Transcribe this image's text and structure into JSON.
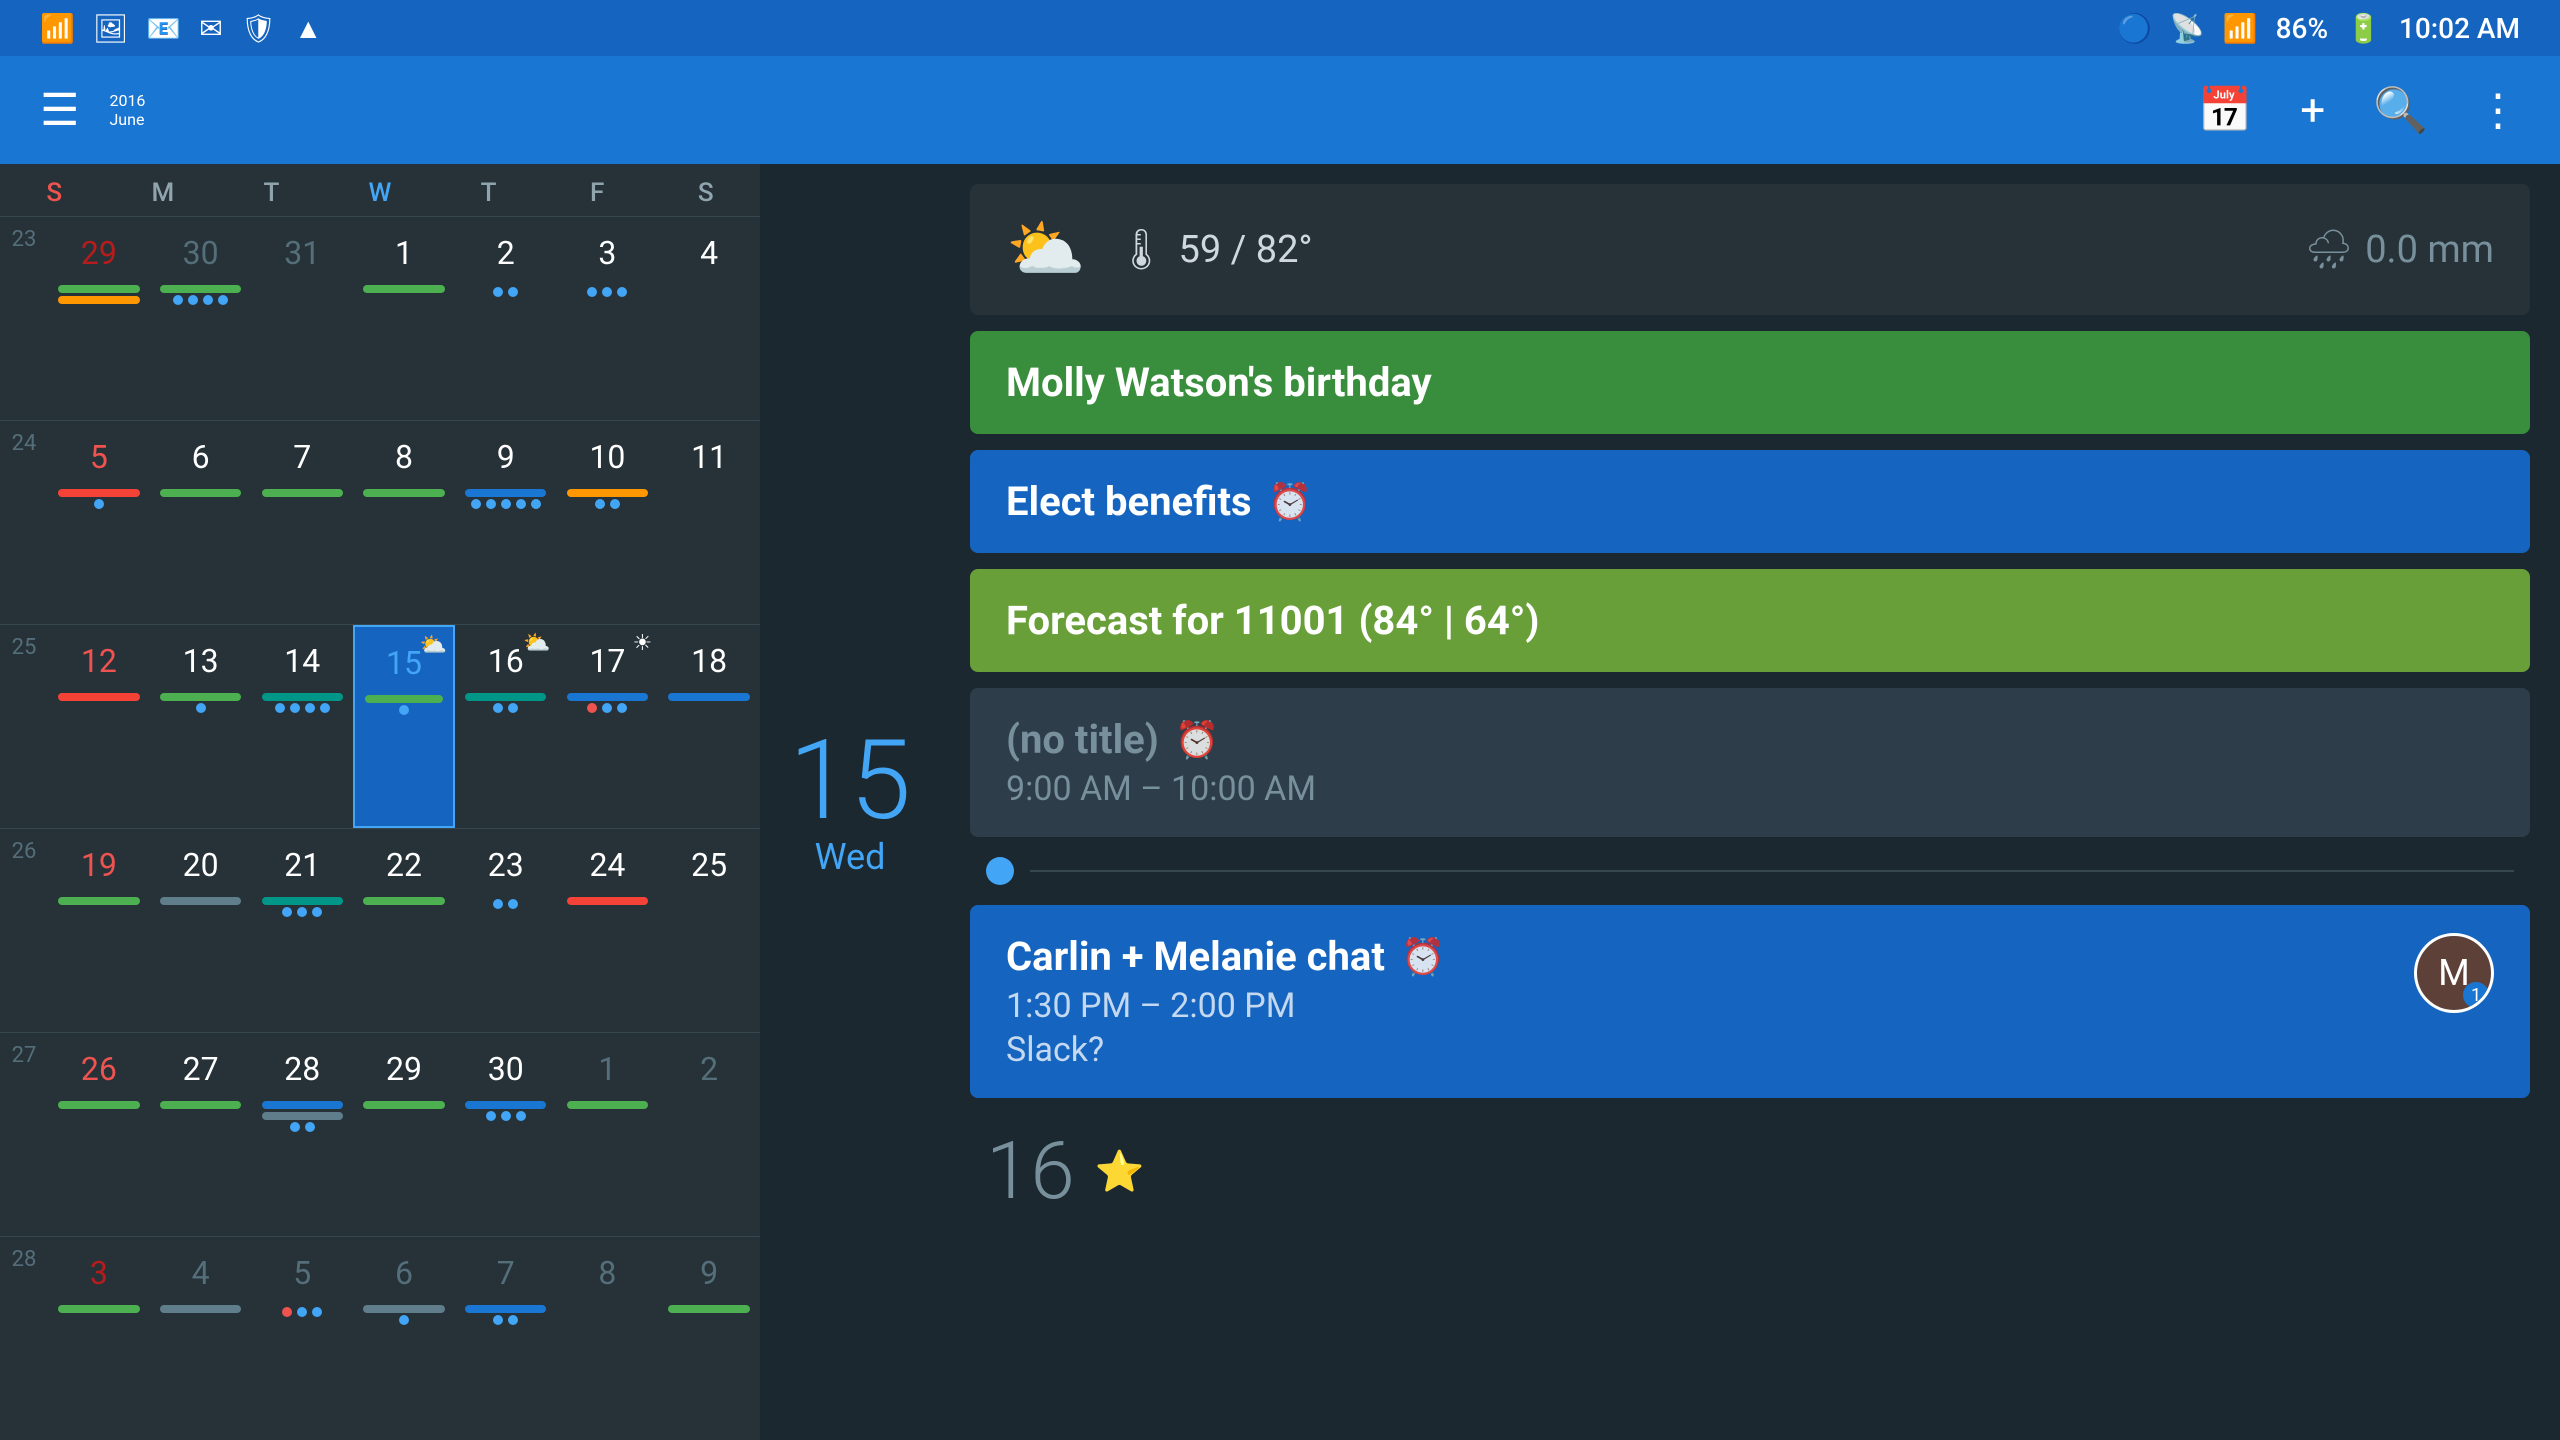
{
  "statusBar": {
    "time": "10:02 AM",
    "battery": "86%",
    "signal": "●●●●",
    "wifi": "WiFi",
    "bluetooth": "BT"
  },
  "appBar": {
    "year": "2016",
    "month": "June",
    "menuIcon": "☰",
    "calendarIcon": "📅",
    "addIcon": "+",
    "searchIcon": "🔍",
    "moreIcon": "⋮"
  },
  "calendar": {
    "weekNumbers": [
      23,
      24,
      25,
      26,
      27,
      28
    ],
    "dayHeaders": [
      "S",
      "M",
      "T",
      "W",
      "T",
      "F",
      "S"
    ],
    "weeks": [
      {
        "weekNum": 23,
        "days": [
          {
            "num": "29",
            "type": "overflow sunday",
            "bars": [
              "green",
              "orange"
            ],
            "dots": []
          },
          {
            "num": "30",
            "type": "overflow",
            "bars": [
              "green"
            ],
            "dots": [
              "blue",
              "blue",
              "blue",
              "blue"
            ]
          },
          {
            "num": "31",
            "type": "overflow",
            "bars": [],
            "dots": []
          },
          {
            "num": "1",
            "type": "normal wednesday",
            "bars": [
              "green"
            ],
            "dots": []
          },
          {
            "num": "2",
            "type": "normal",
            "bars": [],
            "dots": [
              "blue",
              "blue"
            ]
          },
          {
            "num": "3",
            "type": "normal",
            "bars": [],
            "dots": [
              "blue",
              "blue",
              "blue"
            ]
          },
          {
            "num": "4",
            "type": "normal",
            "bars": [],
            "dots": []
          }
        ]
      },
      {
        "weekNum": 24,
        "days": [
          {
            "num": "5",
            "type": "sunday",
            "bars": [
              "red"
            ],
            "dots": [
              "blue"
            ]
          },
          {
            "num": "6",
            "type": "normal",
            "bars": [
              "green"
            ],
            "dots": []
          },
          {
            "num": "7",
            "type": "normal",
            "bars": [
              "green"
            ],
            "dots": []
          },
          {
            "num": "8",
            "type": "normal wednesday",
            "bars": [
              "green"
            ],
            "dots": []
          },
          {
            "num": "9",
            "type": "normal",
            "bars": [
              "blue"
            ],
            "dots": [
              "blue",
              "blue",
              "blue",
              "blue",
              "blue"
            ]
          },
          {
            "num": "10",
            "type": "normal",
            "bars": [
              "orange"
            ],
            "dots": [
              "blue",
              "blue"
            ]
          },
          {
            "num": "11",
            "type": "normal",
            "bars": [],
            "dots": []
          }
        ]
      },
      {
        "weekNum": 25,
        "days": [
          {
            "num": "12",
            "type": "sunday",
            "bars": [
              "red"
            ],
            "dots": []
          },
          {
            "num": "13",
            "type": "normal",
            "bars": [
              "green"
            ],
            "dots": [
              "blue"
            ]
          },
          {
            "num": "14",
            "type": "normal",
            "bars": [
              "teal"
            ],
            "dots": [
              "blue",
              "blue",
              "blue",
              "blue"
            ]
          },
          {
            "num": "15",
            "type": "selected today",
            "bars": [
              "green"
            ],
            "dots": [
              "blue"
            ],
            "weather": "⛅"
          },
          {
            "num": "16",
            "type": "normal",
            "bars": [
              "teal"
            ],
            "dots": [
              "blue",
              "blue"
            ],
            "weather": "⛅"
          },
          {
            "num": "17",
            "type": "normal",
            "bars": [
              "blue"
            ],
            "dots": [
              "red",
              "blue",
              "blue"
            ],
            "weather": "☀"
          },
          {
            "num": "18",
            "type": "normal",
            "bars": [
              "blue"
            ],
            "dots": []
          }
        ]
      },
      {
        "weekNum": 26,
        "days": [
          {
            "num": "19",
            "type": "sunday",
            "bars": [
              "green"
            ],
            "dots": []
          },
          {
            "num": "20",
            "type": "normal",
            "bars": [
              "gray"
            ],
            "dots": []
          },
          {
            "num": "21",
            "type": "normal",
            "bars": [
              "teal"
            ],
            "dots": [
              "blue",
              "blue",
              "blue"
            ]
          },
          {
            "num": "22",
            "type": "normal wednesday",
            "bars": [
              "green"
            ],
            "dots": []
          },
          {
            "num": "23",
            "type": "normal",
            "bars": [],
            "dots": [
              "blue",
              "blue"
            ]
          },
          {
            "num": "24",
            "type": "normal",
            "bars": [
              "red"
            ],
            "dots": []
          },
          {
            "num": "25",
            "type": "normal",
            "bars": [],
            "dots": []
          }
        ]
      },
      {
        "weekNum": 27,
        "days": [
          {
            "num": "26",
            "type": "sunday",
            "bars": [
              "green"
            ],
            "dots": []
          },
          {
            "num": "27",
            "type": "normal",
            "bars": [
              "green"
            ],
            "dots": []
          },
          {
            "num": "28",
            "type": "normal",
            "bars": [
              "blue",
              "gray"
            ],
            "dots": [
              "blue",
              "blue"
            ]
          },
          {
            "num": "29",
            "type": "normal wednesday",
            "bars": [
              "green"
            ],
            "dots": []
          },
          {
            "num": "30",
            "type": "normal",
            "bars": [
              "blue"
            ],
            "dots": [
              "blue",
              "blue",
              "blue"
            ]
          },
          {
            "num": "1",
            "type": "overflow",
            "bars": [
              "green"
            ],
            "dots": []
          },
          {
            "num": "2",
            "type": "overflow",
            "bars": [],
            "dots": []
          }
        ]
      },
      {
        "weekNum": 28,
        "days": [
          {
            "num": "3",
            "type": "overflow sunday",
            "bars": [
              "green"
            ],
            "dots": []
          },
          {
            "num": "4",
            "type": "overflow",
            "bars": [
              "gray"
            ],
            "dots": []
          },
          {
            "num": "5",
            "type": "overflow",
            "bars": [],
            "dots": [
              "red",
              "blue",
              "blue"
            ]
          },
          {
            "num": "6",
            "type": "overflow wednesday",
            "bars": [
              "gray"
            ],
            "dots": [
              "blue"
            ]
          },
          {
            "num": "7",
            "type": "overflow",
            "bars": [
              "blue"
            ],
            "dots": [
              "blue",
              "blue"
            ]
          },
          {
            "num": "8",
            "type": "overflow",
            "bars": [],
            "dots": []
          },
          {
            "num": "9",
            "type": "overflow",
            "bars": [
              "green"
            ],
            "dots": []
          }
        ]
      }
    ]
  },
  "rightPanel": {
    "selectedDate": {
      "day": "15",
      "dayName": "Wed"
    },
    "weather": {
      "icon": "⛅",
      "tempIcon": "🌡",
      "tempRange": "59 / 82°",
      "rainIcon": "🌧",
      "rainAmount": "0.0 mm"
    },
    "events": [
      {
        "type": "green",
        "title": "Molly Watson's birthday",
        "hasAlarm": false
      },
      {
        "type": "blue",
        "title": "Elect benefits",
        "hasAlarm": true,
        "alarmIcon": "⏰"
      },
      {
        "type": "lime",
        "title": "Forecast for 11001 (84° | 64°)",
        "hasAlarm": false
      },
      {
        "type": "dark",
        "title": "(no title)",
        "hasAlarm": true,
        "alarmIcon": "⏰",
        "time": "9:00 AM – 10:00 AM"
      }
    ],
    "timelineDot": true,
    "carlinEvent": {
      "type": "blue",
      "title": "Carlin + Melanie chat",
      "hasAlarm": true,
      "alarmIcon": "⏰",
      "time": "1:30 PM – 2:00 PM",
      "sub": "Slack?",
      "avatarLabel": "M",
      "avatarBadge": "1"
    },
    "nextDay": {
      "num": "16",
      "starIcon": "⭐"
    }
  }
}
